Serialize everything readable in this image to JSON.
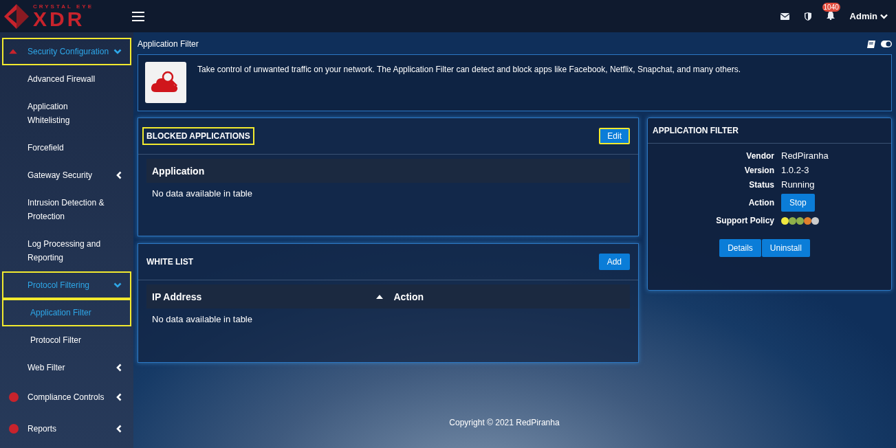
{
  "header": {
    "logo": {
      "tagline": "CRYSTAL EYE",
      "name": "XDR"
    },
    "notification_count": "1040",
    "user": "Admin"
  },
  "sidebar": {
    "items": [
      {
        "label": "Security Configuration",
        "expanded": true,
        "selected": true,
        "highlighted": true,
        "children": [
          {
            "label": "Advanced Firewall",
            "selected": false,
            "highlighted": false
          },
          {
            "label": "Application Whitelisting",
            "selected": false,
            "highlighted": false
          },
          {
            "label": "Forcefield",
            "selected": false,
            "highlighted": false
          },
          {
            "label": "Gateway Security",
            "expanded": false,
            "selected": false,
            "highlighted": false
          },
          {
            "label": "Intrusion Detection & Protection",
            "selected": false,
            "highlighted": false
          },
          {
            "label": "Log Processing and Reporting",
            "selected": false,
            "highlighted": false
          },
          {
            "label": "Protocol Filtering",
            "expanded": true,
            "selected": true,
            "highlighted": true,
            "children": [
              {
                "label": "Application Filter",
                "selected": true,
                "highlighted": true
              },
              {
                "label": "Protocol Filter",
                "selected": false,
                "highlighted": false
              }
            ]
          },
          {
            "label": "Web Filter",
            "expanded": false,
            "selected": false,
            "highlighted": false
          }
        ]
      },
      {
        "label": "Compliance Controls",
        "expanded": false,
        "selected": false,
        "highlighted": false
      },
      {
        "label": "Reports",
        "expanded": false,
        "selected": false,
        "highlighted": false
      }
    ]
  },
  "page_title": "Application Filter",
  "banner": {
    "text": "Take control of unwanted traffic on your network. The Application Filter can detect and block apps like Facebook, Netflix, Snapchat, and many others."
  },
  "panels": [
    {
      "title": "BLOCKED APPLICATIONS",
      "highlighted": true,
      "button": {
        "label": "Edit",
        "highlighted": true
      },
      "columns": [
        {
          "label": "Application",
          "sorted": false
        }
      ],
      "empty_text": "No data available in table"
    },
    {
      "title": "WHITE LIST",
      "highlighted": false,
      "button": {
        "label": "Add",
        "highlighted": false
      },
      "columns": [
        {
          "label": "IP Address",
          "sorted": true
        },
        {
          "label": "Action",
          "sorted": false
        }
      ],
      "empty_text": "No data available in table"
    }
  ],
  "app_card": {
    "title": "APPLICATION FILTER",
    "rows": [
      {
        "label": "Vendor",
        "kind": "text",
        "value": "RedPiranha"
      },
      {
        "label": "Version",
        "kind": "text",
        "value": "1.0.2-3"
      },
      {
        "label": "Status",
        "kind": "text",
        "value": "Running"
      },
      {
        "label": "Action",
        "kind": "button",
        "value": "Stop"
      },
      {
        "label": "Support Policy",
        "kind": "dots",
        "dots": [
          {
            "color": "#f0e840"
          },
          {
            "color": "#8fb04a"
          },
          {
            "color": "#8fb04a"
          },
          {
            "color": "#e07f2c"
          },
          {
            "color": "#cccccc"
          }
        ]
      }
    ],
    "buttons": [
      "Details",
      "Uninstall"
    ]
  },
  "footer": {
    "copyright": "Copyright © 2021 RedPiranha"
  }
}
